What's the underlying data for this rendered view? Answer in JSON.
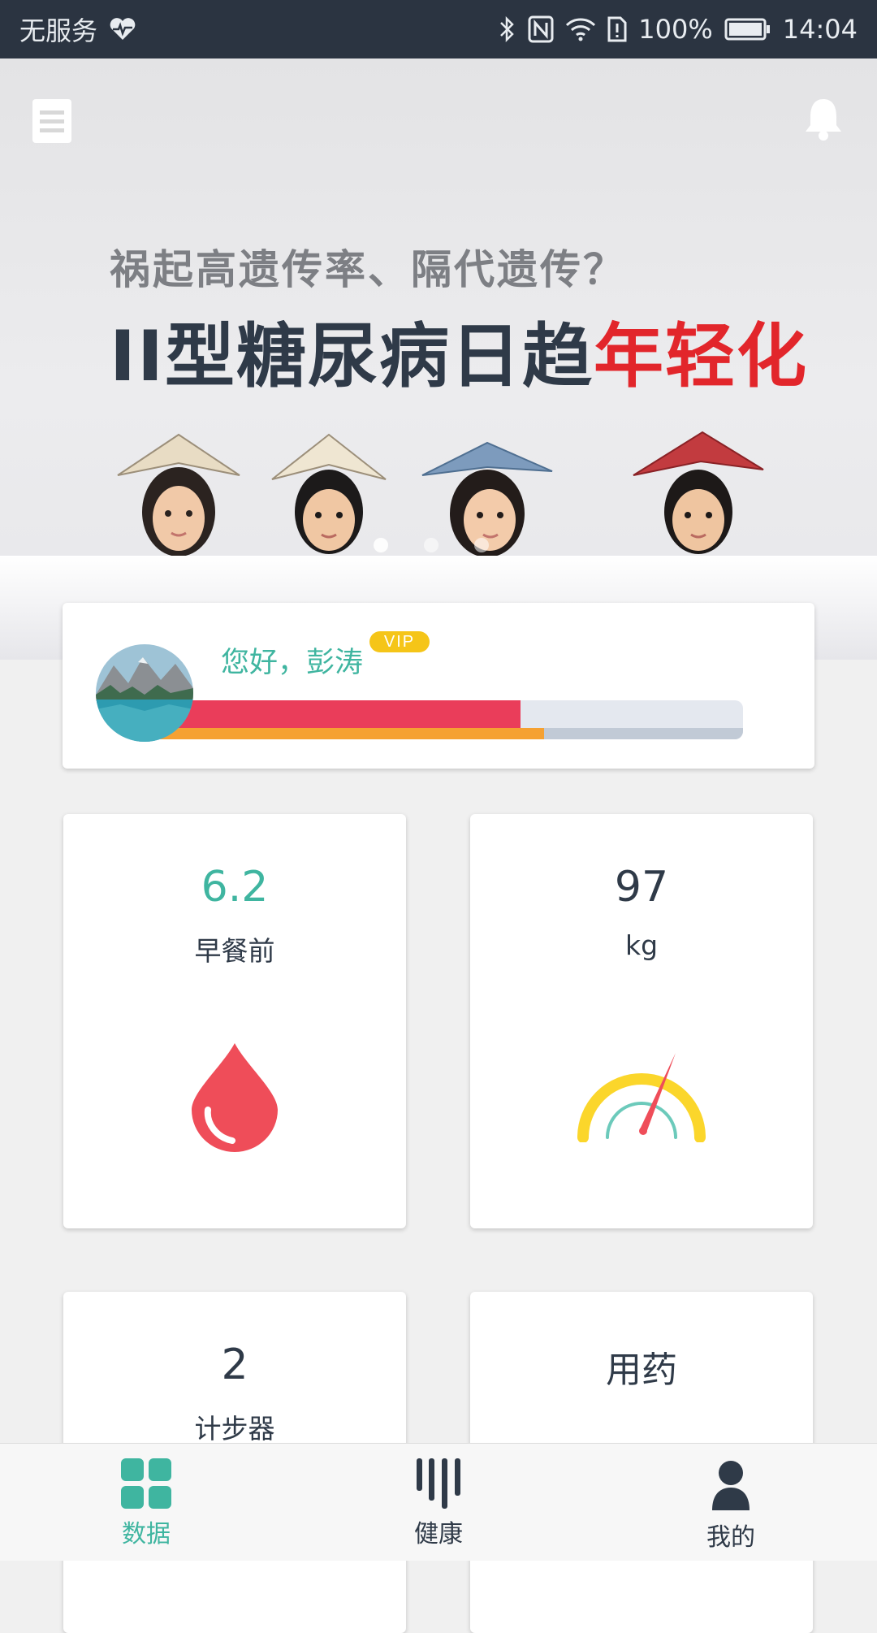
{
  "status_bar": {
    "carrier": "无服务",
    "battery": "100%",
    "time": "14:04",
    "icons": [
      "heart-rate-icon",
      "bluetooth-icon",
      "nfc-icon",
      "wifi-icon",
      "sim-alert-icon",
      "battery-icon"
    ]
  },
  "banner": {
    "subtitle": "祸起高遗传率、隔代遗传？",
    "headline_main": "II型糖尿病日趋",
    "headline_accent": "年轻化",
    "slide_count": 3,
    "active_slide": 1,
    "icons": [
      "menu-icon",
      "bell-icon"
    ]
  },
  "user": {
    "greeting": "您好，彭涛",
    "badge": "VIP",
    "progress_primary": 0.62,
    "progress_secondary": 0.66
  },
  "tiles": {
    "glucose": {
      "value": "6.2",
      "label": "早餐前",
      "icon": "blood-drop-icon"
    },
    "weight": {
      "value": "97",
      "label": "kg",
      "icon": "gauge-icon"
    },
    "steps": {
      "value": "2",
      "label": "计步器"
    },
    "meds": {
      "label": "用药"
    }
  },
  "tab_bar": {
    "items": [
      {
        "label": "数据",
        "icon": "grid-icon",
        "active": true
      },
      {
        "label": "健康",
        "icon": "bars-icon",
        "active": false
      },
      {
        "label": "我的",
        "icon": "person-icon",
        "active": false
      }
    ]
  },
  "colors": {
    "accent": "#3fb5a0",
    "status_bar": "#2b3441",
    "progress_red": "#ea3d5a",
    "progress_orange": "#f5a132",
    "vip": "#f5c518",
    "drop": "#ef4d59",
    "gauge": "#fbd62b"
  }
}
